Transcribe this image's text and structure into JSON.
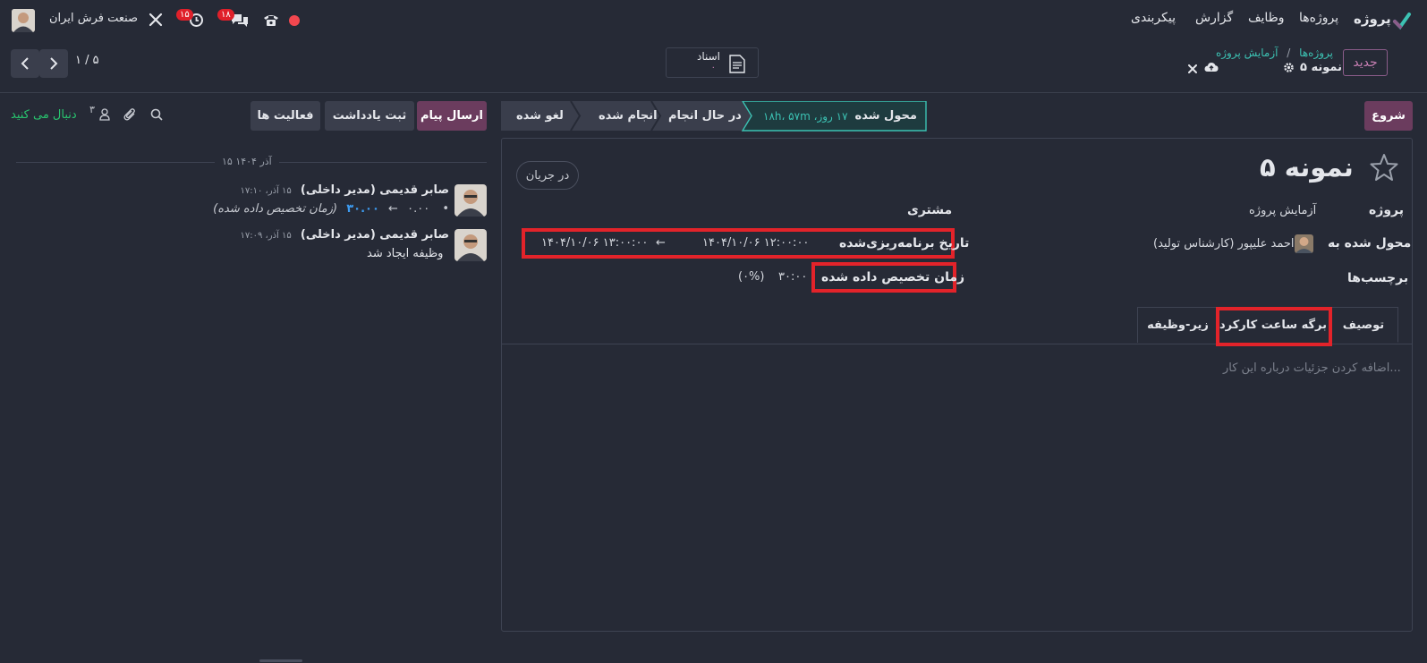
{
  "app": {
    "menu": [
      "پروژه",
      "پروژه‌ها",
      "وظایف",
      "گزارش",
      "پیکربندی"
    ],
    "company": "صنعت فرش ایران",
    "messages_badge": "۱۸",
    "activity_badge": "۱۵"
  },
  "control": {
    "new_button": "جدید",
    "breadcrumb_root": "پروژه‌ها",
    "breadcrumb_sep": "/",
    "breadcrumb_parent": "آزمایش پروژه",
    "record_title": "نمونه ۵",
    "documents_label": "اسناد",
    "documents_count": "۰",
    "pager": "۱ / ۵"
  },
  "status": {
    "start_button": "شروع",
    "stages": [
      "محول شده",
      "در حال انجام",
      "انجام شده",
      "لغو شده"
    ],
    "active_stage_duration": "۱۷ روز، ۱۸h، ۵۷m"
  },
  "form": {
    "title": "نمونه ۵",
    "state_pill": "در جریان",
    "fields": {
      "project_label": "پروژه",
      "project_value": "آزمایش پروژه",
      "assignee_label": "محول شده به",
      "assignee_value": "احمد علیپور (کارشناس تولید)",
      "tags_label": "برچسب‌ها",
      "customer_label": "مشتری",
      "planned_label": "تاریخ برنامه‌ریزی‌شده",
      "planned_start": "۱۴۰۴/۱۰/۰۶ ۱۲:۰۰:۰۰",
      "planned_arrow": "←",
      "planned_end": "۱۴۰۴/۱۰/۰۶ ۱۳:۰۰:۰۰",
      "allocated_label": "زمان تخصیص داده شده",
      "allocated_value": "۳۰:۰۰",
      "allocated_percent": "(۰%)"
    },
    "tabs": [
      "توصیف",
      "برگه ساعت کارکرد",
      "زیر-وظیفه"
    ],
    "description_placeholder": "اضافه کردن جزئیات درباره این کار..."
  },
  "chatter": {
    "send_message": "ارسال پیام",
    "log_note": "ثبت یادداشت",
    "activities": "فعالیت ها",
    "followers_count": "۳",
    "follow_label": "دنبال می کنید",
    "date_separator": "۱۵ آذر ۱۴۰۴",
    "messages": [
      {
        "author": "صابر قدیمی (مدیر داخلی)",
        "time": "۱۵ آذر، ۱۷:۱۰",
        "old_value": "۰.۰۰",
        "arrow": "←",
        "new_value": "۳۰.۰۰",
        "field": "(زمان تخصیص داده شده)"
      },
      {
        "author": "صابر قدیمی (مدیر داخلی)",
        "time": "۱۵ آذر، ۱۷:۰۹",
        "body": "وظیفه ایجاد شد"
      }
    ]
  },
  "colors": {
    "background": "#262a36",
    "primary": "#6b3c5e",
    "accent_teal": "#3cc2b3",
    "highlight_red": "#e3232a",
    "follow_green": "#28c46e"
  }
}
